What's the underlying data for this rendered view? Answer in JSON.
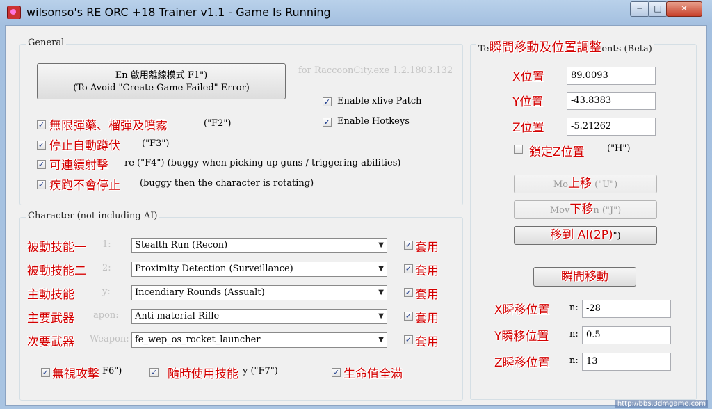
{
  "window": {
    "title": "wilsonso's RE ORC +18 Trainer v1.1 - Game Is Running",
    "minimize": "─",
    "maximize": "□",
    "close": "✕"
  },
  "general": {
    "title": "General",
    "enable_button_line1": "En 啟用離線模式 F1\")",
    "enable_button_line2": "(To Avoid \"Create Game Failed\" Error)",
    "for_text": "for RaccoonCity.exe 1.2.1803.132",
    "xlive_patch": "Enable xlive Patch",
    "hotkeys": "Enable Hotkeys",
    "options": [
      {
        "red": "無限彈藥、榴彈及噴霧",
        "rest": "(\"F2\")"
      },
      {
        "red": "停止自動蹲伏",
        "rest": "(\"F3\")"
      },
      {
        "red": "可連續射擊",
        "rest": "re (\"F4\") (buggy when picking up guns / triggering abilities)"
      },
      {
        "red": "疾跑不會停止",
        "rest": "(buggy then the character is rotating)"
      }
    ]
  },
  "character": {
    "title": "Character (not including AI)",
    "rows": [
      {
        "red": "被動技能一",
        "ghost": "1:",
        "value": "Stealth Run (Recon)",
        "apply": "套用"
      },
      {
        "red": "被動技能二",
        "ghost": "2:",
        "value": "Proximity Detection (Surveillance)",
        "apply": "套用"
      },
      {
        "red": "主動技能",
        "ghost": "y:",
        "value": "Incendiary Rounds (Assualt)",
        "apply": "套用"
      },
      {
        "red": "主要武器",
        "ghost": "apon:",
        "value": "Anti-material Rifle",
        "apply": "套用"
      },
      {
        "red": "次要武器",
        "ghost": "Weapon:",
        "value": "fe_wep_os_rocket_launcher",
        "apply": "套用"
      }
    ],
    "bottom": [
      {
        "red": "無視攻擊",
        "rest": "F6\")"
      },
      {
        "red": "隨時使用技能",
        "rest": "y (\"F7\")"
      },
      {
        "red": "生命值全滿",
        "rest": ""
      }
    ]
  },
  "teleport": {
    "title_left": "Te",
    "title_red": "瞬間移動及位置調整",
    "title_right": "ents (Beta)",
    "pos": [
      {
        "red": "X位置",
        "value": "89.0093"
      },
      {
        "red": "Y位置",
        "value": "-43.8383"
      },
      {
        "red": "Z位置",
        "value": "-5.21262"
      }
    ],
    "lock_red": "鎖定Z位置",
    "lock_rest": "(\"H\")",
    "up_ghost": "Mo",
    "up_red": "上移",
    "up_rest": "(\"U\")",
    "down_ghost": "Mov",
    "down_red": "下移",
    "down_rest": "n (\"J\")",
    "ai_red": "移到 AI(2P)",
    "ai_rest": "\")",
    "teleport_btn": "瞬間移動",
    "tp": [
      {
        "red": "X瞬移位置",
        "ghost": "n:",
        "value": "-28"
      },
      {
        "red": "Y瞬移位置",
        "ghost": "n:",
        "value": "0.5"
      },
      {
        "red": "Z瞬移位置",
        "ghost": "n:",
        "value": "13"
      }
    ]
  },
  "watermark": "http://bbs.3dmgame.com"
}
